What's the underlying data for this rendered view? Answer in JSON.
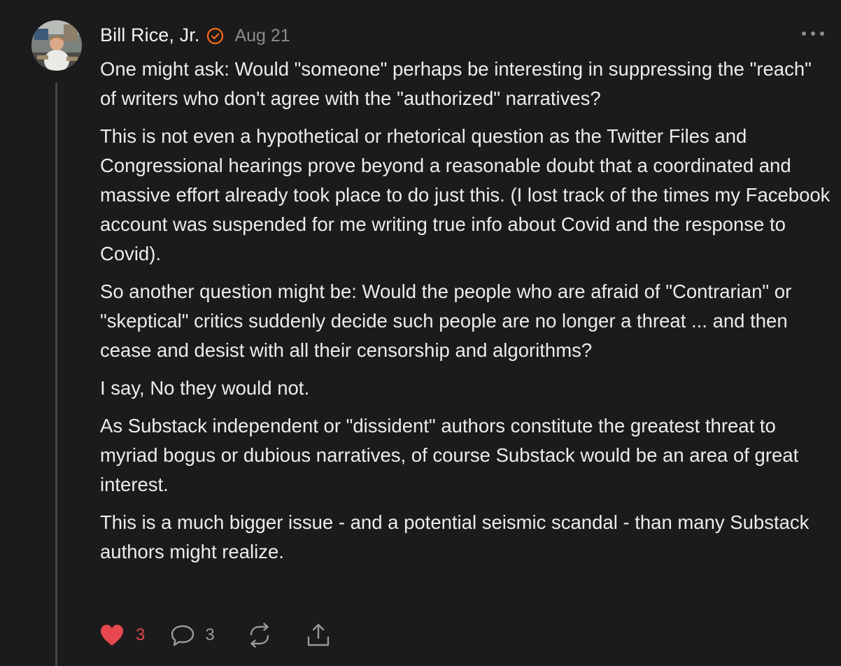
{
  "comment": {
    "author": "Bill Rice, Jr.",
    "date": "Aug 21",
    "paragraphs": [
      "One might ask: Would \"someone\" perhaps be interesting in suppressing the \"reach\" of writers who don't agree with the \"authorized\" narratives?",
      "This is not even a hypothetical or rhetorical question as the Twitter Files and Congressional hearings prove beyond a reasonable doubt that a coordinated and massive effort already took place to do just this. (I lost track of the times my Facebook account was suspended for me writing true info about Covid and the response to Covid).",
      "So another question might be: Would the people who are afraid of \"Contrarian\" or \"skeptical\" critics suddenly decide such people are no longer a threat ... and then cease and desist with all their censorship and algorithms?",
      "I say, No they would not.",
      "As Substack independent or \"dissident\" authors constitute the greatest threat to myriad bogus or dubious narratives, of course Substack would be an area of great interest.",
      "This is a much bigger issue - and a potential seismic scandal - than many Substack authors might realize."
    ],
    "actions": {
      "like_count": "3",
      "reply_count": "3"
    }
  },
  "icons": {
    "badge": "verified-check-icon",
    "more": "more-horizontal-icon",
    "like": "heart-icon",
    "reply": "speech-bubble-icon",
    "restack": "restack-icon",
    "share": "share-icon"
  },
  "colors": {
    "background": "#1b1b1d",
    "text": "#ececec",
    "muted": "#8c8c8f",
    "badge": "#ff6719",
    "like": "#e5484d",
    "thread_line": "#454548"
  }
}
